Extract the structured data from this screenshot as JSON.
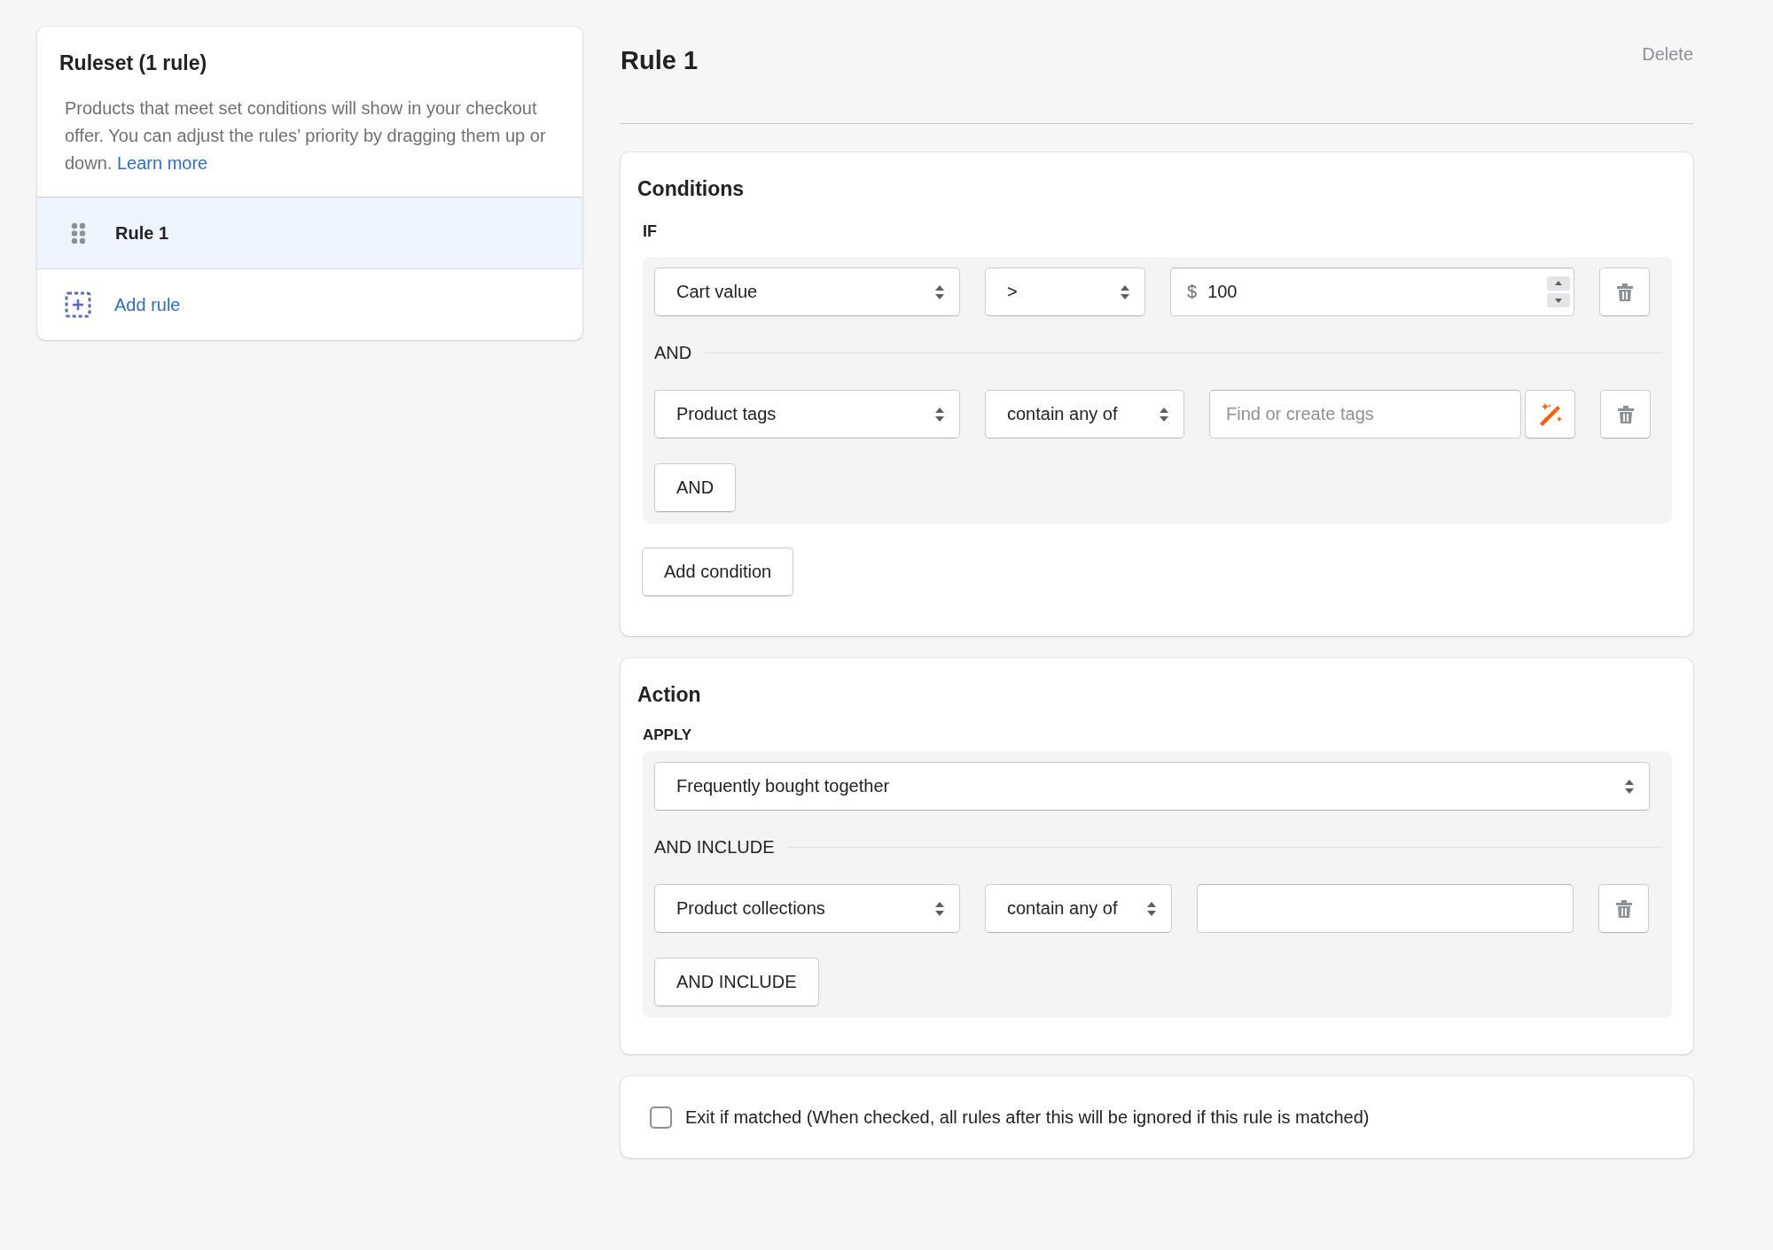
{
  "ruleset": {
    "title": "Ruleset (1 rule)",
    "description": "Products that meet set conditions will show in your checkout offer. You can adjust the rules’ priority by dragging them up or down.",
    "link": "Learn more",
    "rules": [
      {
        "label": "Rule 1",
        "selected": true
      }
    ],
    "add_rule": "Add rule"
  },
  "rule": {
    "title": "Rule 1",
    "delete": "Delete"
  },
  "conditions": {
    "title": "Conditions",
    "if_label": "IF",
    "rows": [
      {
        "kind": "number",
        "field": "Cart value",
        "operator": ">",
        "prefix": "$",
        "value": "100"
      },
      {
        "kind": "tags",
        "joiner": "AND",
        "field": "Product tags",
        "operator": "contain any of",
        "placeholder": "Find or create tags"
      }
    ],
    "and_button": "AND",
    "add_button": "Add condition"
  },
  "action": {
    "title": "Action",
    "apply_label": "APPLY",
    "apply_value": "Frequently bought together",
    "rows": [
      {
        "kind": "text",
        "joiner": "AND INCLUDE",
        "field": "Product collections",
        "operator": "contain any of"
      }
    ],
    "and_include_button": "AND INCLUDE"
  },
  "exit": {
    "label": "Exit if matched (When checked, all rules after this will be ignored if this rule is matched)",
    "checked": false
  }
}
